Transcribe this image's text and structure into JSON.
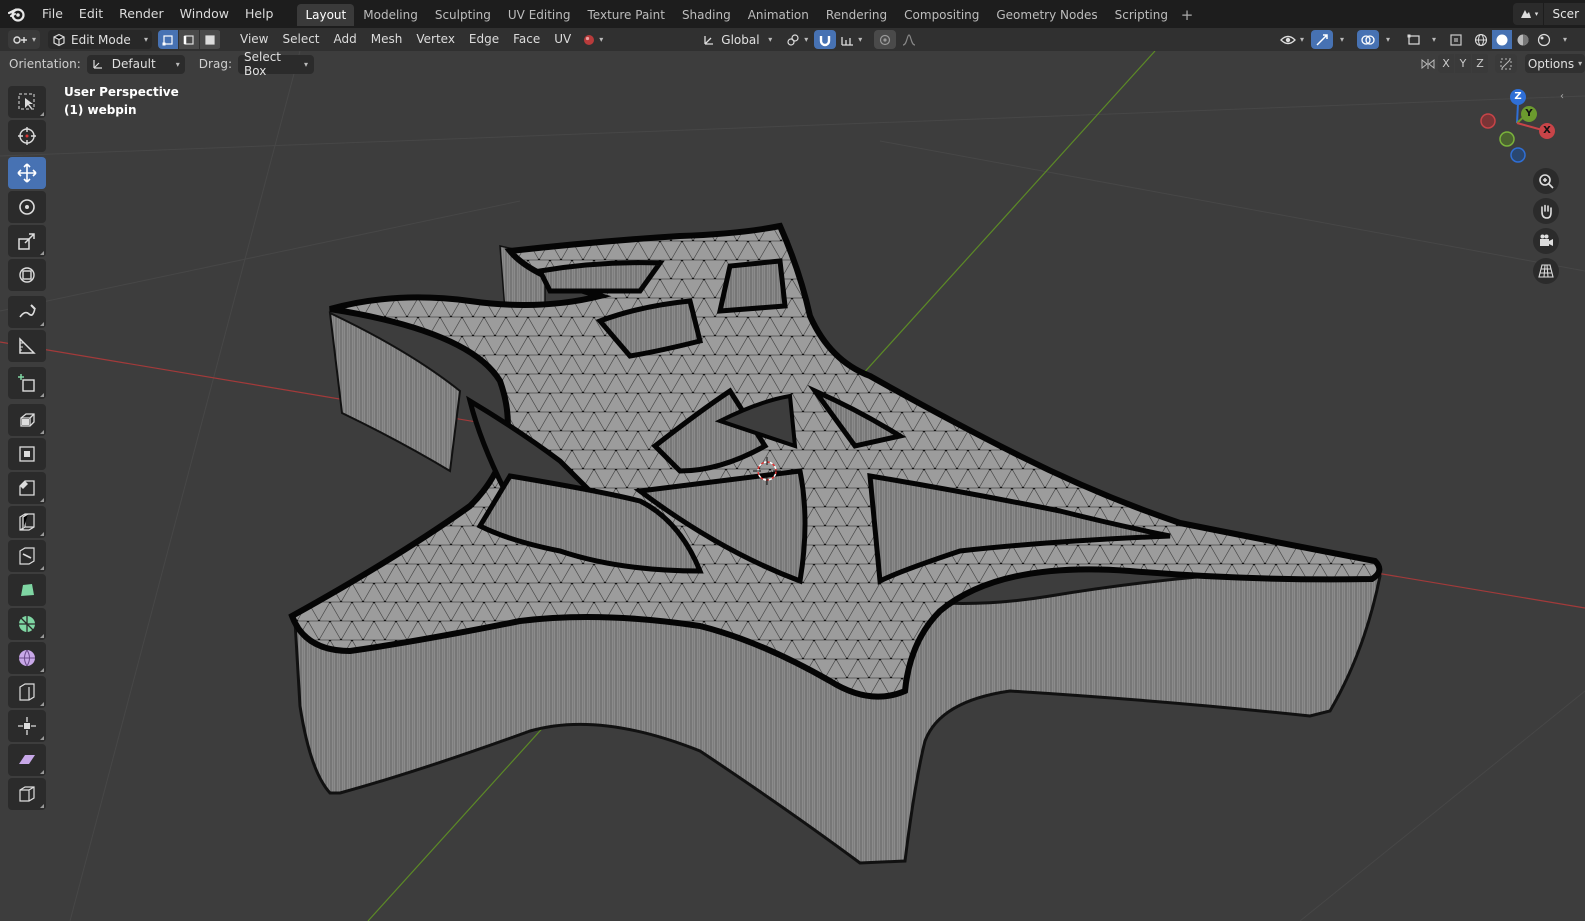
{
  "menubar": {
    "items": [
      "File",
      "Edit",
      "Render",
      "Window",
      "Help"
    ],
    "workspaces": [
      "Layout",
      "Modeling",
      "Sculpting",
      "UV Editing",
      "Texture Paint",
      "Shading",
      "Animation",
      "Rendering",
      "Compositing",
      "Geometry Nodes",
      "Scripting"
    ],
    "active_workspace": "Layout",
    "add_tab": "+",
    "scene_label": "Scer"
  },
  "header": {
    "mode": "Edit Mode",
    "menus": [
      "View",
      "Select",
      "Add",
      "Mesh",
      "Vertex",
      "Edge",
      "Face",
      "UV"
    ],
    "transform_orientation": "Global"
  },
  "tool_settings": {
    "orientation_label": "Orientation:",
    "orientation_value": "Default",
    "drag_label": "Drag:",
    "drag_value": "Select Box",
    "axes": [
      "X",
      "Y",
      "Z"
    ],
    "options_label": "Options"
  },
  "viewport": {
    "view_name": "User Perspective",
    "object_name": "(1) webpin"
  },
  "gizmo": {
    "x": "X",
    "y": "Y",
    "z": "Z"
  },
  "toolbar": {
    "tools": [
      "select-box",
      "cursor",
      "move",
      "rotate",
      "scale",
      "transform",
      "annotate",
      "measure",
      "add-cube",
      "extrude",
      "inset",
      "bevel",
      "loop-cut",
      "knife",
      "poly-build",
      "spin",
      "smooth",
      "edge-slide",
      "shrink-fatten",
      "shear",
      "rip"
    ],
    "active_tool": "move"
  },
  "colors": {
    "accent": "#4772b3",
    "x_axis": "#c84448",
    "y_axis": "#6b9a2e",
    "z_axis": "#2f6fd6"
  }
}
